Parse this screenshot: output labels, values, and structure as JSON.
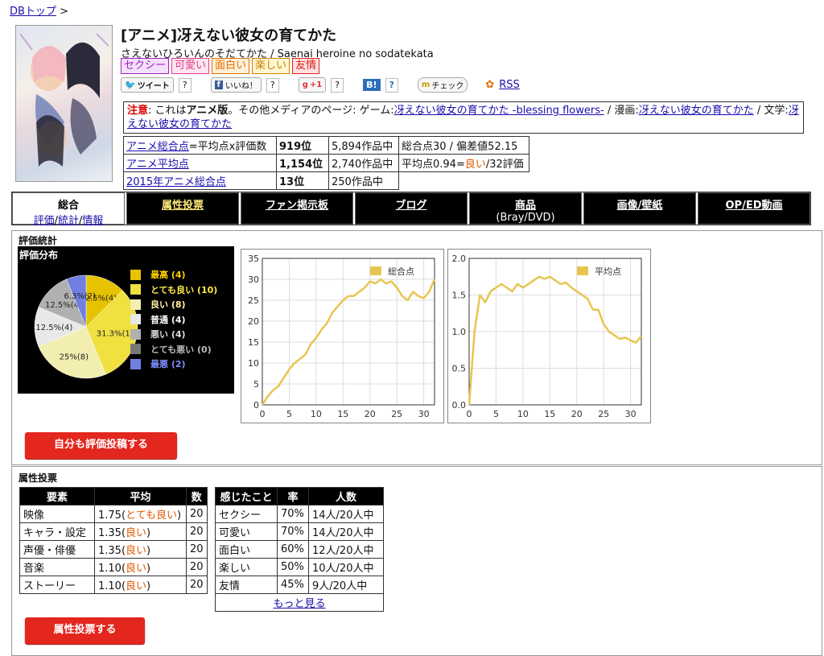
{
  "breadcrumb": {
    "link": "DBトップ",
    "sep": ">"
  },
  "title": "[アニメ]冴えない彼女の育てかた",
  "subtitle": "さえないひろいんのそだてかた / Saenai heroine no sodatekata",
  "tags": [
    {
      "label": "セクシー",
      "color": "#a020c0",
      "bg": "#f3e0fa"
    },
    {
      "label": "可愛い",
      "color": "#e0408a",
      "bg": "#fde6f0"
    },
    {
      "label": "面白い",
      "color": "#e07000",
      "bg": "#fdf0d8"
    },
    {
      "label": "楽しい",
      "color": "#d08000",
      "bg": "#fdf6d0"
    },
    {
      "label": "友情",
      "color": "#e02020",
      "bg": "#fde0e0"
    }
  ],
  "social": {
    "tweet": "ツイート",
    "tweet_count": "?",
    "like": "いいね！",
    "like_count": "?",
    "gplus": "+1",
    "gplus_count": "?",
    "hatena": "B!",
    "hatena_count": "?",
    "check": "チェック",
    "rss": "RSS"
  },
  "notice": {
    "label": "注意",
    "text1": ": これは",
    "bold": "アニメ版",
    "text2": "。その他メディアのページ: ゲーム:",
    "game_link": "冴えない彼女の育てかた -blessing flowers-",
    "text3": " / 漫画:",
    "manga_link": "冴えない彼女の育てかた",
    "text4": " / 文学:",
    "lit_link": "冴えない彼女の育てかた"
  },
  "ranks": [
    {
      "name": "アニメ総合点",
      "note": "=平均点x評価数",
      "rank": "919位",
      "total": "5,894作品中",
      "extra": "総合点30 / 偏差値52.15"
    },
    {
      "name": "アニメ平均点",
      "note": "",
      "rank": "1,154位",
      "total": "2,740作品中",
      "extra_pre": "平均点0.94=",
      "extra_orange": "良い",
      "extra_post": "/32評価"
    },
    {
      "name": "2015年アニメ総合点",
      "note": "",
      "rank": "13位",
      "total": "250作品中",
      "extra": ""
    }
  ],
  "tabs": [
    {
      "label": "総合",
      "sub": [
        "評価",
        "統計",
        "情報"
      ]
    },
    {
      "label": "属性投票"
    },
    {
      "label": "ファン掲示板"
    },
    {
      "label": "ブログ"
    },
    {
      "label": "商品",
      "sub2": "(Bray/DVD)"
    },
    {
      "label": "画像/壁紙"
    },
    {
      "label": "OP/ED動画"
    }
  ],
  "stats": {
    "section_title": "評価統計",
    "dist_title": "評価分布",
    "button": "自分も評価投稿する"
  },
  "pie": {
    "legend": [
      {
        "label": "最高 (4)",
        "color": "#e6c200",
        "text": "#ffd400"
      },
      {
        "label": "とても良い (10)",
        "color": "#f0e040",
        "text": "#ffe94a"
      },
      {
        "label": "良い (8)",
        "color": "#f2eeb0",
        "text": "#fff3a0"
      },
      {
        "label": "普通 (4)",
        "color": "#e8e8e8",
        "text": "#ffffff"
      },
      {
        "label": "悪い (4)",
        "color": "#b0b0b0",
        "text": "#dddddd"
      },
      {
        "label": "とても悪い (0)",
        "color": "#777777",
        "text": "#bbbbbb"
      },
      {
        "label": "最悪 (2)",
        "color": "#7080e0",
        "text": "#8090ff"
      }
    ],
    "labels": [
      "6.3%(2)",
      "12.5%(4)",
      "12.5%(4)",
      "12.5%(4)",
      "31.3%(10)",
      "25%(8)"
    ]
  },
  "chart_data": [
    {
      "type": "pie",
      "title": "評価分布",
      "categories": [
        "最高",
        "とても良い",
        "良い",
        "普通",
        "悪い",
        "とても悪い",
        "最悪"
      ],
      "values": [
        4,
        10,
        8,
        4,
        4,
        0,
        2
      ],
      "percent_labels": [
        "12.5%(4)",
        "31.3%(10)",
        "25%(8)",
        "12.5%(4)",
        "12.5%(4)",
        "",
        "6.3%(2)"
      ],
      "colors": [
        "#e6c200",
        "#f0e040",
        "#f2eeb0",
        "#e8e8e8",
        "#b0b0b0",
        "#777777",
        "#7080e0"
      ]
    },
    {
      "type": "line",
      "legend": "総合点",
      "series": [
        {
          "name": "総合点",
          "x": [
            0,
            1,
            2,
            3,
            4,
            5,
            6,
            7,
            8,
            9,
            10,
            11,
            12,
            13,
            14,
            15,
            16,
            17,
            18,
            19,
            20,
            21,
            22,
            23,
            24,
            25,
            26,
            27,
            28,
            29,
            30,
            31,
            32
          ],
          "values": [
            0,
            2,
            3.5,
            4.5,
            6.5,
            8.5,
            10,
            11,
            12,
            14.5,
            16,
            18,
            19.5,
            22,
            23.5,
            25,
            26,
            26,
            27,
            28,
            29.5,
            29,
            30,
            29,
            29.5,
            28,
            26,
            25,
            27,
            26,
            25.5,
            27,
            30
          ]
        }
      ],
      "xlim": [
        0,
        32
      ],
      "ylim": [
        0,
        35
      ],
      "xticks": [
        0,
        5,
        10,
        15,
        20,
        25,
        30
      ],
      "yticks": [
        0,
        5,
        10,
        15,
        20,
        25,
        30,
        35
      ]
    },
    {
      "type": "line",
      "legend": "平均点",
      "series": [
        {
          "name": "平均点",
          "x": [
            0,
            1,
            2,
            3,
            4,
            5,
            6,
            7,
            8,
            9,
            10,
            11,
            12,
            13,
            14,
            15,
            16,
            17,
            18,
            19,
            20,
            21,
            22,
            23,
            24,
            25,
            26,
            27,
            28,
            29,
            30,
            31,
            32
          ],
          "values": [
            0,
            1.0,
            1.5,
            1.4,
            1.55,
            1.6,
            1.65,
            1.6,
            1.55,
            1.65,
            1.6,
            1.65,
            1.7,
            1.75,
            1.72,
            1.75,
            1.7,
            1.65,
            1.67,
            1.6,
            1.55,
            1.5,
            1.45,
            1.3,
            1.3,
            1.1,
            1.0,
            0.95,
            0.9,
            0.92,
            0.88,
            0.85,
            0.94
          ]
        }
      ],
      "xlim": [
        0,
        32
      ],
      "ylim": [
        0,
        2.0
      ],
      "xticks": [
        0,
        5,
        10,
        15,
        20,
        25,
        30
      ],
      "yticks": [
        0,
        0.5,
        1.0,
        1.5,
        2.0
      ]
    }
  ],
  "attr": {
    "section_title": "属性投票",
    "headers1": [
      "要素",
      "平均",
      "数"
    ],
    "rows1": [
      {
        "name": "映像",
        "avg": "1.75(",
        "rate": "とても良い",
        "close": ")",
        "n": "20"
      },
      {
        "name": "キャラ・設定",
        "avg": "1.35(",
        "rate": "良い",
        "close": ")",
        "n": "20"
      },
      {
        "name": "声優・俳優",
        "avg": "1.35(",
        "rate": "良い",
        "close": ")",
        "n": "20"
      },
      {
        "name": "音楽",
        "avg": "1.10(",
        "rate": "良い",
        "close": ")",
        "n": "20"
      },
      {
        "name": "ストーリー",
        "avg": "1.10(",
        "rate": "良い",
        "close": ")",
        "n": "20"
      }
    ],
    "headers2": [
      "感じたこと",
      "率",
      "人数"
    ],
    "rows2": [
      {
        "feel": "セクシー",
        "rate": "70%",
        "people": "14人/20人中"
      },
      {
        "feel": "可愛い",
        "rate": "70%",
        "people": "14人/20人中"
      },
      {
        "feel": "面白い",
        "rate": "60%",
        "people": "12人/20人中"
      },
      {
        "feel": "楽しい",
        "rate": "50%",
        "people": "10人/20人中"
      },
      {
        "feel": "友情",
        "rate": "45%",
        "people": "9人/20人中"
      }
    ],
    "more": "もっと見る",
    "button": "属性投票する"
  }
}
